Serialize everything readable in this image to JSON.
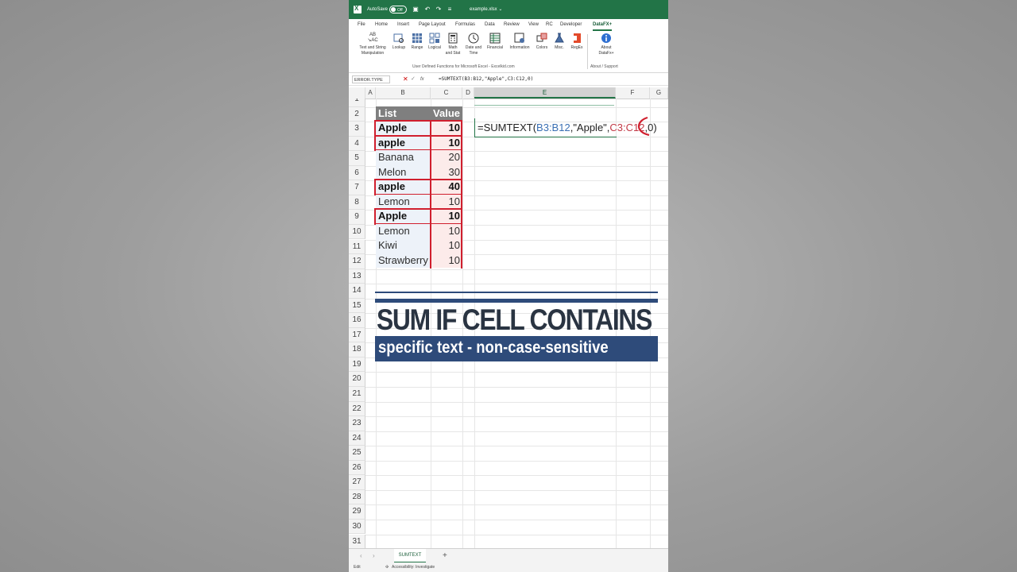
{
  "titlebar": {
    "autosave_label": "AutoSave",
    "autosave_state": "Off",
    "filename": "example.xlsx ⌄"
  },
  "menu": {
    "tabs": [
      "File",
      "Home",
      "Insert",
      "Page Layout",
      "Formulas",
      "Data",
      "Review",
      "View",
      "RC",
      "Developer",
      "DataFX+"
    ],
    "active_tab": "DataFX+"
  },
  "ribbon": {
    "buttons": [
      {
        "label_1": "Text and String",
        "label_2": "Manipulation",
        "icon": "ab-ac-icon"
      },
      {
        "label_1": "Lookup",
        "label_2": "",
        "icon": "lookup-icon"
      },
      {
        "label_1": "Range",
        "label_2": "",
        "icon": "range-icon"
      },
      {
        "label_1": "Logical",
        "label_2": "",
        "icon": "logical-icon"
      },
      {
        "label_1": "Math",
        "label_2": "and Stat",
        "icon": "calculator-icon"
      },
      {
        "label_1": "Date and",
        "label_2": "Time",
        "icon": "clock-icon"
      },
      {
        "label_1": "Financial",
        "label_2": "",
        "icon": "financial-icon"
      },
      {
        "label_1": "Information",
        "label_2": "",
        "icon": "information-icon"
      },
      {
        "label_1": "Colors",
        "label_2": "",
        "icon": "colors-icon"
      },
      {
        "label_1": "Misc.",
        "label_2": "",
        "icon": "flask-icon"
      },
      {
        "label_1": "RegEx",
        "label_2": "",
        "icon": "office-icon"
      },
      {
        "label_1": "About",
        "label_2": "DataFx+",
        "icon": "info-icon"
      }
    ],
    "group_main": "User Defined Functions for Microsoft Excel - Excelkid.com",
    "group_about": "About / Support"
  },
  "formula_bar": {
    "name_box": "ERROR.TYPE",
    "formula": "=SUMTEXT(B3:B12,\"Apple\",C3:C12,0)"
  },
  "columns": [
    "A",
    "B",
    "C",
    "D",
    "E",
    "F",
    "G"
  ],
  "selected_column": "E",
  "rows": [
    "1",
    "2",
    "3",
    "4",
    "5",
    "6",
    "7",
    "8",
    "9",
    "10",
    "11",
    "12",
    "13",
    "14",
    "15",
    "16",
    "17",
    "18",
    "19",
    "20",
    "21",
    "22",
    "23",
    "24",
    "25",
    "26",
    "27",
    "28",
    "29",
    "30",
    "31"
  ],
  "table": {
    "header_list": "List",
    "header_value": "Value",
    "items": [
      {
        "name": "Apple",
        "value": "10",
        "highlight": true
      },
      {
        "name": "apple",
        "value": "10",
        "highlight": true
      },
      {
        "name": "Banana",
        "value": "20",
        "highlight": false
      },
      {
        "name": "Melon",
        "value": "30",
        "highlight": false
      },
      {
        "name": "apple",
        "value": "40",
        "highlight": true
      },
      {
        "name": "Lemon",
        "value": "10",
        "highlight": false
      },
      {
        "name": "Apple",
        "value": "10",
        "highlight": true
      },
      {
        "name": "Lemon",
        "value": "10",
        "highlight": false
      },
      {
        "name": "Kiwi",
        "value": "10",
        "highlight": false
      },
      {
        "name": "Strawberry",
        "value": "10",
        "highlight": false
      }
    ]
  },
  "editing_cell": {
    "prefix": "=SUMTEXT(",
    "ref1": "B3:B12",
    "mid": ",\"Apple\",",
    "ref2": "C3:C12",
    "suffix": ",0)"
  },
  "banner": {
    "title": "SUM IF CELL CONTAINS",
    "subtitle": "specific text - non-case-sensitive"
  },
  "sheet": {
    "tab_name": "SUMTEXT",
    "add_label": "+"
  },
  "status": {
    "mode": "Edit",
    "accessibility": "Accessibility: Investigate"
  },
  "colors": {
    "excel_green": "#227447",
    "banner_blue": "#2e4b7a",
    "highlight_red": "#d01f2e"
  }
}
